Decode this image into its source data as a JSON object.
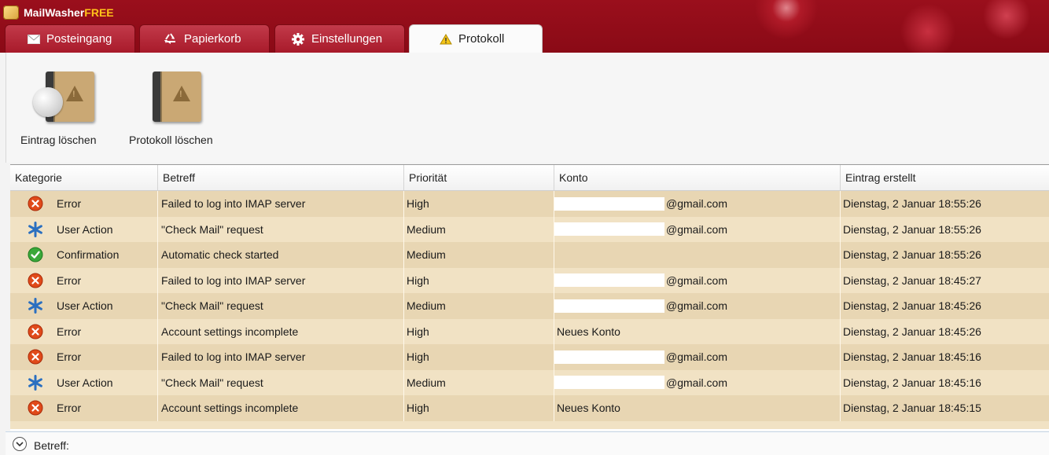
{
  "app": {
    "name_main": "MailWasher",
    "name_suffix": "FREE",
    "accent": "#ffc21a",
    "titlebar_color": "#9a0f1c"
  },
  "tabs": [
    {
      "label": "Posteingang",
      "icon": "envelope-icon",
      "active": false
    },
    {
      "label": "Papierkorb",
      "icon": "recycle-icon",
      "active": false
    },
    {
      "label": "Einstellungen",
      "icon": "gear-icon",
      "active": false
    },
    {
      "label": "Protokoll",
      "icon": "warning-icon",
      "active": true
    }
  ],
  "toolbar": {
    "delete_entry_label": "Eintrag löschen",
    "delete_log_label": "Protokoll löschen"
  },
  "grid": {
    "columns": [
      "Kategorie",
      "Betreff",
      "Priorität",
      "Konto",
      "Eintrag erstellt"
    ],
    "rows": [
      {
        "category": "Error",
        "icon": "error-icon",
        "subject": "Failed to log into IMAP server",
        "priority": "High",
        "account": "@gmail.com",
        "account_masked": true,
        "created": "Dienstag, 2 Januar 18:55:26"
      },
      {
        "category": "User Action",
        "icon": "asterisk-icon",
        "subject": "\"Check Mail\" request",
        "priority": "Medium",
        "account": "@gmail.com",
        "account_masked": true,
        "created": "Dienstag, 2 Januar 18:55:26"
      },
      {
        "category": "Confirmation",
        "icon": "check-icon",
        "subject": "Automatic check started",
        "priority": "Medium",
        "account": "",
        "account_masked": false,
        "created": "Dienstag, 2 Januar 18:55:26"
      },
      {
        "category": "Error",
        "icon": "error-icon",
        "subject": "Failed to log into IMAP server",
        "priority": "High",
        "account": "@gmail.com",
        "account_masked": true,
        "created": "Dienstag, 2 Januar 18:45:27"
      },
      {
        "category": "User Action",
        "icon": "asterisk-icon",
        "subject": "\"Check Mail\" request",
        "priority": "Medium",
        "account": "@gmail.com",
        "account_masked": true,
        "created": "Dienstag, 2 Januar 18:45:26"
      },
      {
        "category": "Error",
        "icon": "error-icon",
        "subject": "Account settings incomplete",
        "priority": "High",
        "account": "Neues Konto",
        "account_masked": false,
        "created": "Dienstag, 2 Januar 18:45:26"
      },
      {
        "category": "Error",
        "icon": "error-icon",
        "subject": "Failed to log into IMAP server",
        "priority": "High",
        "account": "@gmail.com",
        "account_masked": true,
        "created": "Dienstag, 2 Januar 18:45:16"
      },
      {
        "category": "User Action",
        "icon": "asterisk-icon",
        "subject": "\"Check Mail\" request",
        "priority": "Medium",
        "account": "@gmail.com",
        "account_masked": true,
        "created": "Dienstag, 2 Januar 18:45:16"
      },
      {
        "category": "Error",
        "icon": "error-icon",
        "subject": "Account settings incomplete",
        "priority": "High",
        "account": "Neues Konto",
        "account_masked": false,
        "created": "Dienstag, 2 Januar 18:45:15"
      }
    ]
  },
  "detail": {
    "label": "Betreff:"
  },
  "colors": {
    "row_odd": "#e8d6b3",
    "row_even": "#f1e2c4",
    "error": "#e04a1a",
    "asterisk": "#2a6fc0",
    "check": "#3aa83a"
  }
}
